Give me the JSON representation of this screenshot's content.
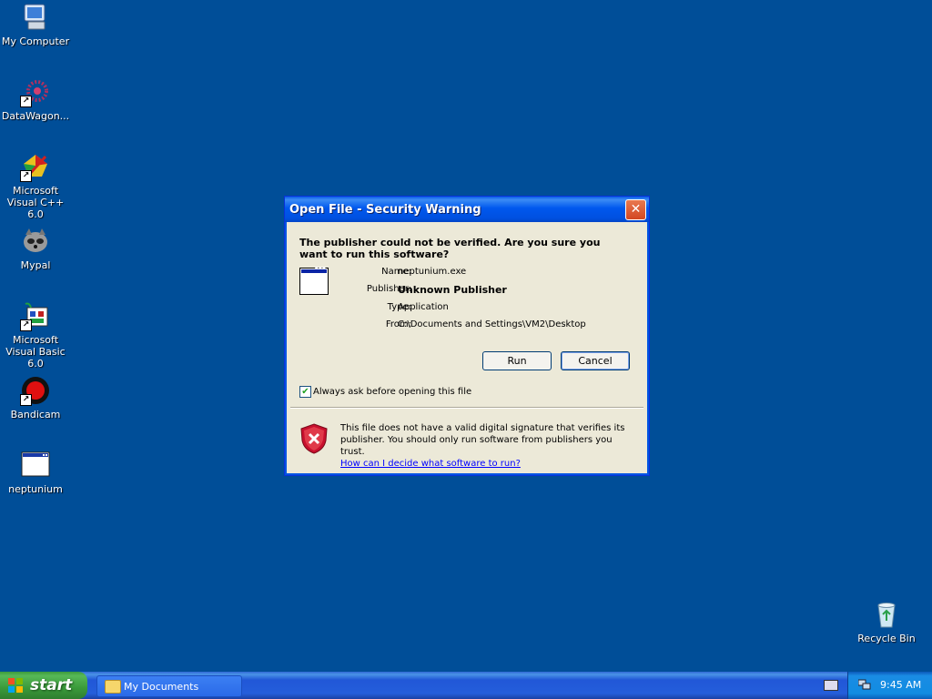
{
  "desktop": {
    "icons": [
      {
        "label": "My Computer",
        "icon": "my-computer-icon"
      },
      {
        "label": "DataWagon...",
        "icon": "datawagon-icon"
      },
      {
        "label": "Microsoft Visual C++ 6.0",
        "icon": "visual-cpp-icon"
      },
      {
        "label": "Mypal",
        "icon": "mypal-icon"
      },
      {
        "label": "Microsoft Visual Basic 6.0",
        "icon": "visual-basic-icon"
      },
      {
        "label": "Bandicam",
        "icon": "bandicam-icon"
      },
      {
        "label": "neptunium",
        "icon": "application-icon"
      },
      {
        "label": "Recycle Bin",
        "icon": "recycle-bin-icon"
      }
    ]
  },
  "dialog": {
    "title": "Open File - Security Warning",
    "close_label": "✕",
    "question": "The publisher could not be verified.  Are you sure you want to run this software?",
    "fields": [
      {
        "key": "Name:",
        "value": "neptunium.exe"
      },
      {
        "key": "Publisher:",
        "value": "Unknown Publisher"
      },
      {
        "key": "Type:",
        "value": "Application"
      },
      {
        "key": "From:",
        "value": "C:\\Documents and Settings\\VM2\\Desktop"
      }
    ],
    "run_label": "Run",
    "cancel_label": "Cancel",
    "checkbox_label": "Always ask before opening this file",
    "checkbox_checked": true,
    "warning_text": "This file does not have a valid digital signature that verifies its publisher.  You should only run software from publishers you trust.",
    "warning_link": "How can I decide what software to run?"
  },
  "taskbar": {
    "start_label": "start",
    "task_item": "My Documents",
    "clock": "9:45 AM"
  },
  "colors": {
    "desktop_bg": "#004e98",
    "title_bar": "#0058ee",
    "start_green": "#3a9a3a",
    "shield_red": "#c8102e"
  }
}
